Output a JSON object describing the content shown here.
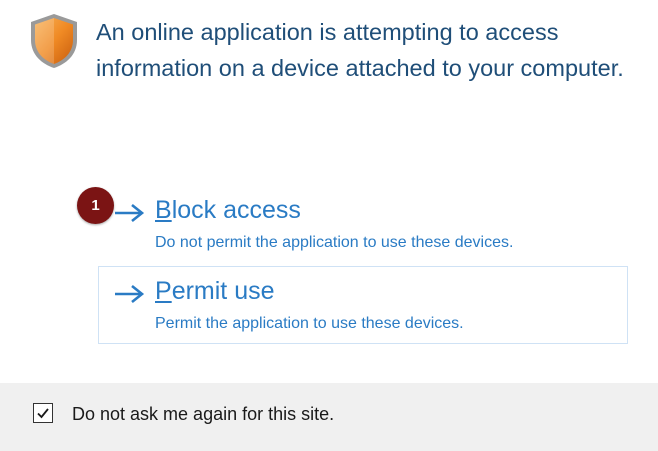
{
  "message": {
    "text": "An online application is attempting to access information on a device attached to your computer."
  },
  "options": [
    {
      "title_underlined_letter": "B",
      "title_rest": "lock access",
      "description": "Do not permit the application to use these devices."
    },
    {
      "title_underlined_letter": "P",
      "title_rest": "ermit use",
      "description": "Permit the application to use these devices."
    }
  ],
  "annotation": {
    "step": "1"
  },
  "footer": {
    "checkbox_checked": true,
    "checkbox_label": "Do not ask me again for this site."
  },
  "colors": {
    "message_text": "#1f4e78",
    "link_text": "#2a7bc4",
    "badge": "#7b1414",
    "footer_background": "#f0f0f0",
    "shield": "#f08a24"
  },
  "icons": {
    "header": "security-shield-icon",
    "option_arrow": "arrow-right-icon",
    "checkbox_mark": "checkmark-icon"
  }
}
